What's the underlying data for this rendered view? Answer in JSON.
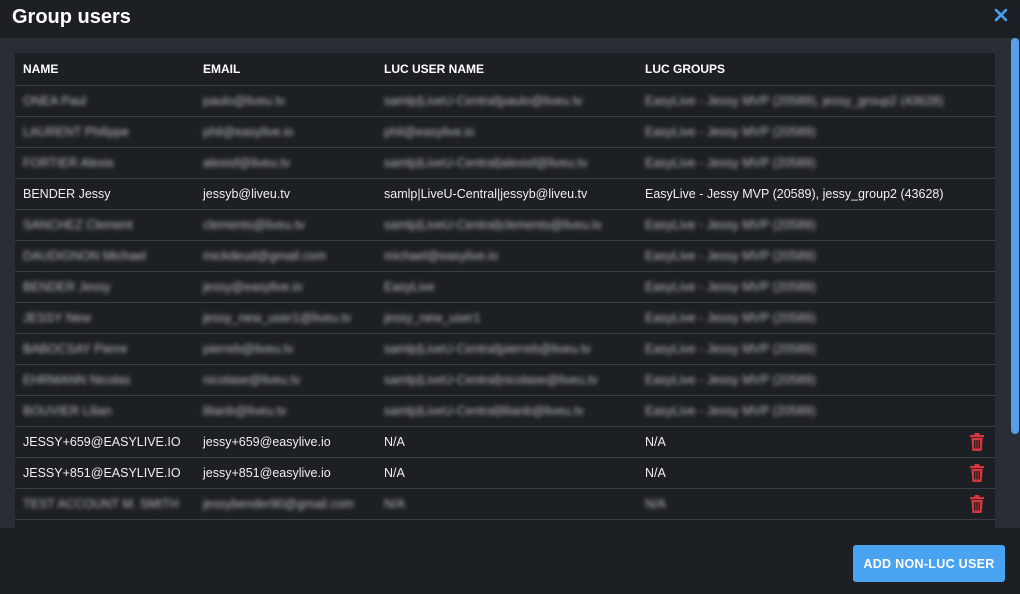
{
  "modal": {
    "title": "Group users"
  },
  "table": {
    "columns": [
      "NAME",
      "EMAIL",
      "LUC USER NAME",
      "LUC GROUPS"
    ],
    "rows": [
      {
        "name": "ONEA Paul",
        "email": "paulo@liveu.tv",
        "luc_user": "samlp|LiveU-Central|paulo@liveu.tv",
        "groups": "EasyLive - Jessy MVP (20589), jessy_group2 (43628)",
        "blurred": true,
        "deletable": false
      },
      {
        "name": "LAURENT Philippe",
        "email": "phil@easylive.io",
        "luc_user": "phil@easylive.io",
        "groups": "EasyLive - Jessy MVP (20589)",
        "blurred": true,
        "deletable": false
      },
      {
        "name": "FORTIER Alexis",
        "email": "alexisf@liveu.tv",
        "luc_user": "samlp|LiveU-Central|alexisf@liveu.tv",
        "groups": "EasyLive - Jessy MVP (20589)",
        "blurred": true,
        "deletable": false
      },
      {
        "name": "BENDER Jessy",
        "email": "jessyb@liveu.tv",
        "luc_user": "samlp|LiveU-Central|jessyb@liveu.tv",
        "groups": "EasyLive - Jessy MVP (20589), jessy_group2 (43628)",
        "blurred": false,
        "deletable": false
      },
      {
        "name": "SANCHEZ Clement",
        "email": "clements@liveu.tv",
        "luc_user": "samlp|LiveU-Central|clements@liveu.tv",
        "groups": "EasyLive - Jessy MVP (20589)",
        "blurred": true,
        "deletable": false
      },
      {
        "name": "DAUDIGNON Michael",
        "email": "mickdeud@gmail.com",
        "luc_user": "michael@easylive.io",
        "groups": "EasyLive - Jessy MVP (20589)",
        "blurred": true,
        "deletable": false
      },
      {
        "name": "BENDER Jessy",
        "email": "jessy@easylive.io",
        "luc_user": "EasyLive",
        "groups": "EasyLive - Jessy MVP (20589)",
        "blurred": true,
        "deletable": false
      },
      {
        "name": "JESSY New",
        "email": "jessy_new_user1@liveu.tv",
        "luc_user": "jessy_new_user1",
        "groups": "EasyLive - Jessy MVP (20589)",
        "blurred": true,
        "deletable": false
      },
      {
        "name": "BABOCSAY Pierre",
        "email": "pierreb@liveu.tv",
        "luc_user": "samlp|LiveU-Central|pierreb@liveu.tv",
        "groups": "EasyLive - Jessy MVP (20589)",
        "blurred": true,
        "deletable": false
      },
      {
        "name": "EHRMANN Nicolas",
        "email": "nicolase@liveu.tv",
        "luc_user": "samlp|LiveU-Central|nicolase@liveu.tv",
        "groups": "EasyLive - Jessy MVP (20589)",
        "blurred": true,
        "deletable": false
      },
      {
        "name": "BOUVIER Lilian",
        "email": "lilianb@liveu.tv",
        "luc_user": "samlp|LiveU-Central|lilianb@liveu.tv",
        "groups": "EasyLive - Jessy MVP (20589)",
        "blurred": true,
        "deletable": false
      },
      {
        "name": "JESSY+659@EASYLIVE.IO",
        "email": "jessy+659@easylive.io",
        "luc_user": "N/A",
        "groups": "N/A",
        "blurred": false,
        "deletable": true
      },
      {
        "name": "JESSY+851@EASYLIVE.IO",
        "email": "jessy+851@easylive.io",
        "luc_user": "N/A",
        "groups": "N/A",
        "blurred": false,
        "deletable": true
      },
      {
        "name": "TEST ACCOUNT M. SMITH",
        "email": "jessybender90@gmail.com",
        "luc_user": "N/A",
        "groups": "N/A",
        "blurred": true,
        "deletable": true
      }
    ]
  },
  "footer": {
    "add_label": "ADD NON-LUC USER"
  },
  "colors": {
    "accent": "#4aa3f0",
    "danger": "#d9363e",
    "close": "#4aa3f0"
  },
  "icons": {
    "close": "close-icon",
    "delete": "trash-icon"
  }
}
